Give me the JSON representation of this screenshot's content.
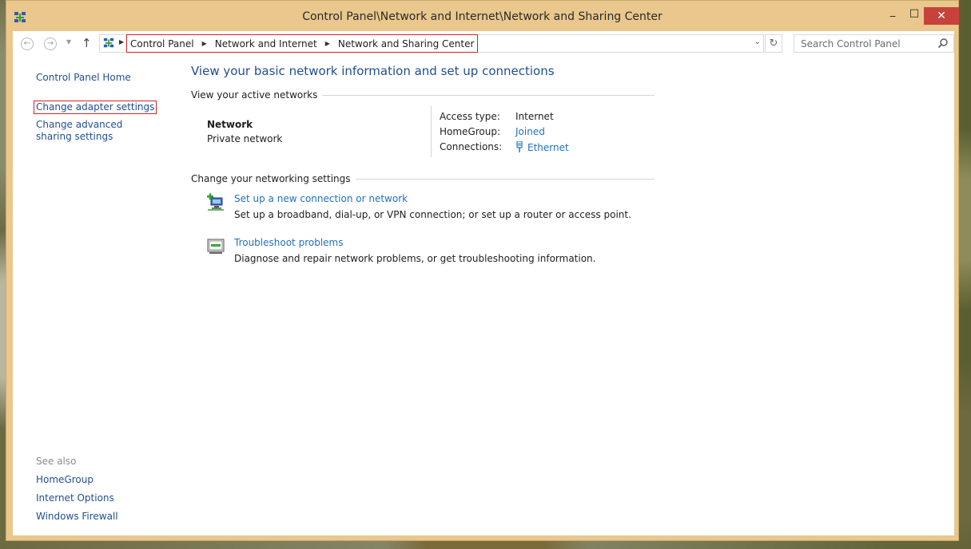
{
  "window": {
    "title": "Control Panel\\Network and Internet\\Network and Sharing Center",
    "min_glyph": "_",
    "max_glyph": "□",
    "close_glyph": "✕"
  },
  "navbar": {
    "breadcrumbs": [
      "Control Panel",
      "Network and Internet",
      "Network and Sharing Center"
    ],
    "search_placeholder": "Search Control Panel",
    "back_glyph": "←",
    "forward_glyph": "→",
    "recent_glyph": "▼",
    "up_glyph": "↑",
    "refresh_glyph": "↻",
    "dropdown_glyph": "⌄",
    "sep_glyph": "▶"
  },
  "sidebar": {
    "home": "Control Panel Home",
    "adapter": "Change adapter settings",
    "advanced": "Change advanced sharing settings",
    "see_also_label": "See also",
    "see_also": [
      "HomeGroup",
      "Internet Options",
      "Windows Firewall"
    ]
  },
  "main": {
    "title": "View your basic network information and set up connections",
    "active_header": "View your active networks",
    "network_name": "Network",
    "network_type": "Private network",
    "access_label": "Access type:",
    "access_value": "Internet",
    "homegroup_label": "HomeGroup:",
    "homegroup_value": "Joined",
    "connections_label": "Connections:",
    "connections_value": "Ethernet",
    "change_header": "Change your networking settings",
    "tasks": [
      {
        "link": "Set up a new connection or network",
        "desc": "Set up a broadband, dial-up, or VPN connection; or set up a router or access point."
      },
      {
        "link": "Troubleshoot problems",
        "desc": "Diagnose and repair network problems, or get troubleshooting information."
      }
    ]
  },
  "colors": {
    "link": "#1f6fc5",
    "heading": "#1f4e94",
    "titlebar": "#e9c78d",
    "close": "#c7423b",
    "highlight_border": "#d42121"
  }
}
